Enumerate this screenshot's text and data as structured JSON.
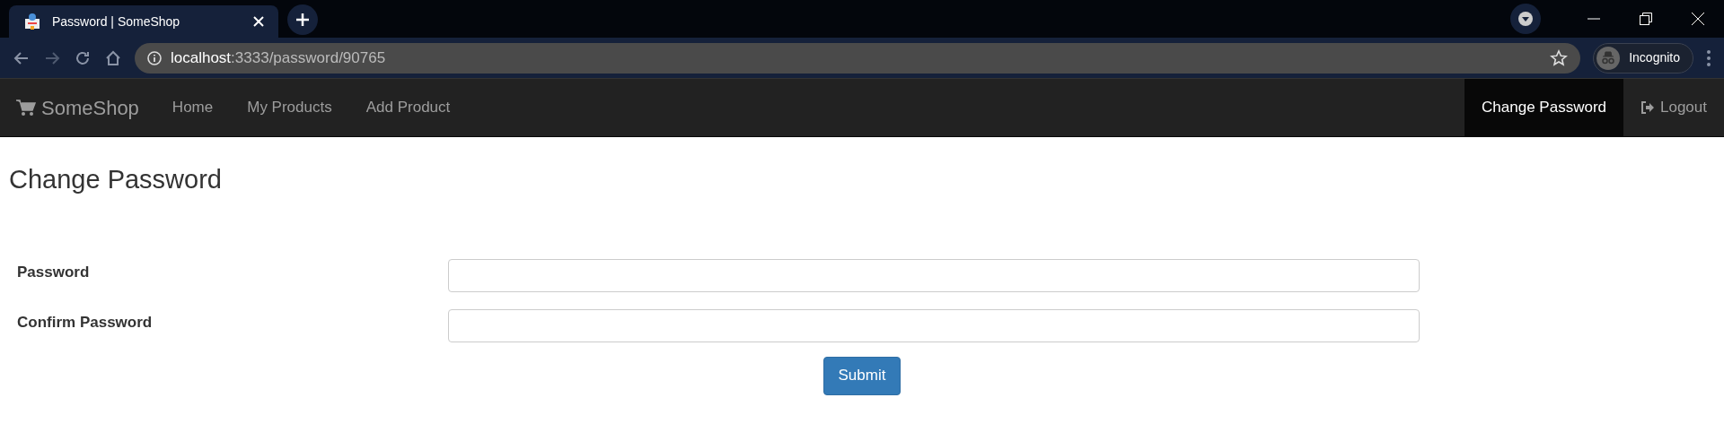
{
  "browser": {
    "tab_title": "Password | SomeShop",
    "url_host": "localhost",
    "url_rest": ":3333/password/90765",
    "profile": "Incognito"
  },
  "navbar": {
    "brand": "SomeShop",
    "left": [
      {
        "label": "Home",
        "selected": false
      },
      {
        "label": "My Products",
        "selected": false
      },
      {
        "label": "Add Product",
        "selected": false
      }
    ],
    "right": [
      {
        "label": "Change Password",
        "selected": true,
        "kind": "text"
      },
      {
        "label": "Logout",
        "selected": false,
        "kind": "logout"
      }
    ]
  },
  "heading": "Change Password",
  "form": {
    "fields": [
      {
        "label": "Password"
      },
      {
        "label": "Confirm Password"
      }
    ],
    "submit": "Submit"
  }
}
